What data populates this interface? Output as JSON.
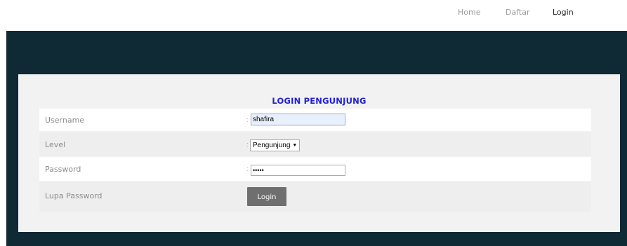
{
  "nav": {
    "home": "Home",
    "daftar": "Daftar",
    "login": "Login"
  },
  "form": {
    "title": "LOGIN PENGUNJUNG",
    "separator": ":",
    "username_label": "Username",
    "username_value": "shafira",
    "level_label": "Level",
    "level_selected": "Pengunjung",
    "password_label": "Password",
    "password_masked": "•••••",
    "forgot_label": "Lupa Password",
    "login_button": "Login"
  },
  "colors": {
    "dark_background": "#0f2a35",
    "panel": "#f2f2f2",
    "title": "#2222cc",
    "button": "#6f6f6f"
  }
}
